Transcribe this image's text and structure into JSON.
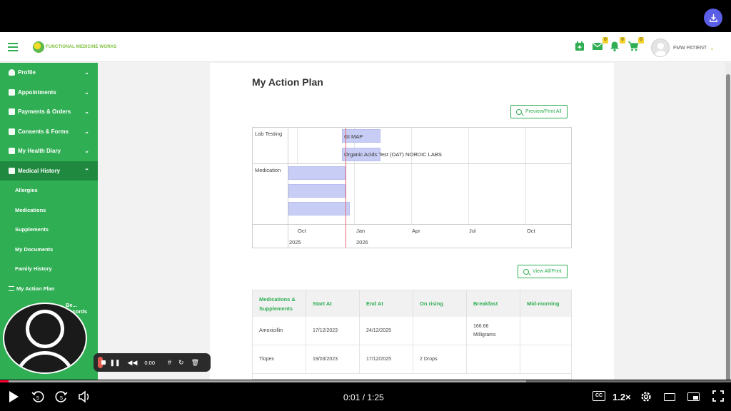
{
  "header": {
    "logo_text": "FUNCTIONAL MEDICINE WORKS",
    "badges": {
      "mail": "0",
      "bell": "0",
      "cart": "0"
    },
    "user_name": "FMW PATIENT"
  },
  "sidebar": {
    "items": [
      {
        "label": "Profile"
      },
      {
        "label": "Appointments"
      },
      {
        "label": "Payments & Orders"
      },
      {
        "label": "Consents & Forms"
      },
      {
        "label": "My Health Diary"
      },
      {
        "label": "Medical History"
      }
    ],
    "sub_items": [
      "Allergies",
      "Medications",
      "Supplements",
      "My Documents",
      "Family History",
      "My Action Plan"
    ],
    "partial_item": "Be... Records"
  },
  "main": {
    "title": "My Action Plan",
    "preview_button": "Preview/Print All",
    "view_button": "View All/Print"
  },
  "gantt": {
    "rows": [
      "Lab Testing",
      "Medication"
    ],
    "bars": [
      "GI MAP",
      "Organic Acids Test (OAT) NORDIC LABS"
    ],
    "months": [
      "Oct",
      "Jan",
      "Apr",
      "Jul",
      "Oct"
    ],
    "years": [
      "2025",
      "2026"
    ]
  },
  "table": {
    "headers": [
      "Medications & Supplements",
      "Start At",
      "End At",
      "On rising",
      "Breakfast",
      "Mid-morning"
    ],
    "rows": [
      {
        "name": "Amoxicillin",
        "start": "17/12/2023",
        "end": "24/12/2025",
        "on_rising": "",
        "breakfast": "166.66 Milligrams",
        "mid": ""
      },
      {
        "name": "Tlopex",
        "start": "19/03/2023",
        "end": "17/12/2025",
        "on_rising": "2 Drops",
        "breakfast": "",
        "mid": ""
      }
    ]
  },
  "recorder": {
    "time": "0:00"
  },
  "player": {
    "time": "0:01 / 1:25",
    "speed": "1.2×",
    "cc": "CC",
    "progress_fraction": 0.012,
    "buffered_fraction": 0.72
  },
  "colors": {
    "brand_green": "#2fae53",
    "active_green": "#1f8a3f",
    "bar_blue": "#c8cdf5",
    "today_red": "#e36a6a",
    "yt_red": "#ff0033",
    "download_purple": "#5b5fe8"
  }
}
